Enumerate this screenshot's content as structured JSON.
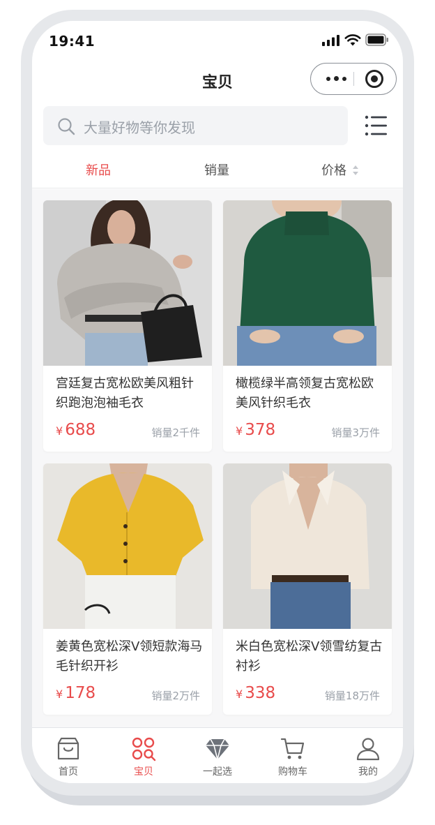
{
  "status_bar": {
    "time": "19:41"
  },
  "nav": {
    "title": "宝贝"
  },
  "search": {
    "placeholder": "大量好物等你发现"
  },
  "tabs": [
    {
      "label": "新品",
      "active": true
    },
    {
      "label": "销量",
      "active": false
    },
    {
      "label": "价格",
      "active": false
    }
  ],
  "products": [
    {
      "title": "宫廷复古宽松欧美风粗针织跑泡泡袖毛衣",
      "currency": "¥",
      "price": "688",
      "sold": "销量2千件"
    },
    {
      "title": "橄榄绿半高领复古宽松欧美风针织毛衣",
      "currency": "¥",
      "price": "378",
      "sold": "销量3万件"
    },
    {
      "title": "姜黄色宽松深V领短款海马毛针织开衫",
      "currency": "¥",
      "price": "178",
      "sold": "销量2万件"
    },
    {
      "title": "米白色宽松深V领雪纺复古衬衫",
      "currency": "¥",
      "price": "338",
      "sold": "销量18万件"
    }
  ],
  "tabbar": [
    {
      "label": "首页",
      "icon": "shop-icon",
      "active": false
    },
    {
      "label": "宝贝",
      "icon": "grid-search-icon",
      "active": true
    },
    {
      "label": "一起选",
      "icon": "diamond-icon",
      "active": false
    },
    {
      "label": "购物车",
      "icon": "cart-icon",
      "active": false
    },
    {
      "label": "我的",
      "icon": "user-icon",
      "active": false
    }
  ],
  "colors": {
    "accent": "#e84b4b",
    "muted": "#9aa0a8",
    "text": "#333333"
  }
}
